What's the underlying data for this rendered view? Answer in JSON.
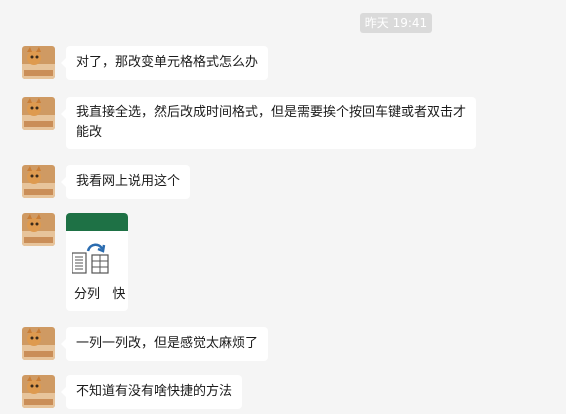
{
  "timestamp": "昨天 19:41",
  "messages": [
    {
      "text": "对了，那改变单元格格式怎么办"
    },
    {
      "text": "我直接全选，然后改成时间格式，但是需要挨个按回车键或者双击才能改"
    },
    {
      "text": "我看网上说用这个"
    },
    {
      "card_label_1": "分列",
      "card_label_2": "快"
    },
    {
      "text": "一列一列改，但是感觉太麻烦了"
    },
    {
      "text": "不知道有没有啥快捷的方法"
    }
  ],
  "colors": {
    "background": "#f5f5f5",
    "bubble": "#ffffff",
    "timestamp_bg": "#dadada",
    "card_header": "#1e7145",
    "avatar": "#d9a066"
  },
  "icons": [
    "cat-avatar",
    "text-to-columns-icon"
  ]
}
